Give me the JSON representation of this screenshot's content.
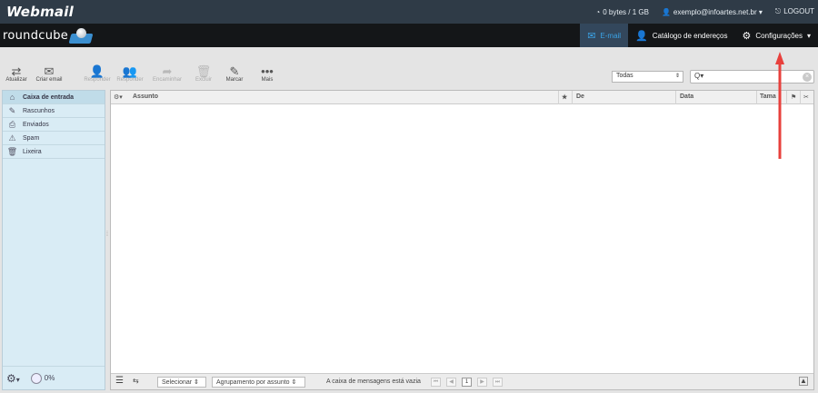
{
  "header": {
    "brand": "Webmail",
    "quota": "0 bytes / 1 GB",
    "user": "exemplo@infoartes.net.br",
    "logout": "LOGOUT"
  },
  "app": {
    "logo": "roundcube",
    "tabs": [
      {
        "label": "E-mail",
        "icon": "mail-icon"
      },
      {
        "label": "Catálogo de endereços",
        "icon": "person-icon"
      },
      {
        "label": "Configurações",
        "icon": "gear-icon"
      }
    ]
  },
  "toolbar": {
    "refresh": "Atualizar",
    "compose": "Criar email",
    "reply": "Responder",
    "reply_all": "Responder",
    "forward": "Encaminhar",
    "delete": "Excluir",
    "mark": "Marcar",
    "more": "Mais"
  },
  "filter": {
    "value": "Todas"
  },
  "search": {
    "placeholder": "Q▾"
  },
  "folders": [
    {
      "label": "Caixa de entrada",
      "icon": "inbox-icon"
    },
    {
      "label": "Rascunhos",
      "icon": "pencil-icon"
    },
    {
      "label": "Enviados",
      "icon": "sent-icon"
    },
    {
      "label": "Spam",
      "icon": "spam-icon"
    },
    {
      "label": "Lixeira",
      "icon": "trash-icon"
    }
  ],
  "quota_percent": "0%",
  "list": {
    "columns": {
      "subject": "Assunto",
      "from": "De",
      "date": "Data",
      "size": "Tama"
    },
    "footer": {
      "select": "Selecionar",
      "grouping": "Agrupamento por assunto",
      "status": "A caixa de mensagens está vazia",
      "page": "1"
    }
  },
  "colors": {
    "topbar": "#2f3b47",
    "appbar": "#141618",
    "accent": "#3ba3e6",
    "annotation_arrow": "#e8403c"
  }
}
